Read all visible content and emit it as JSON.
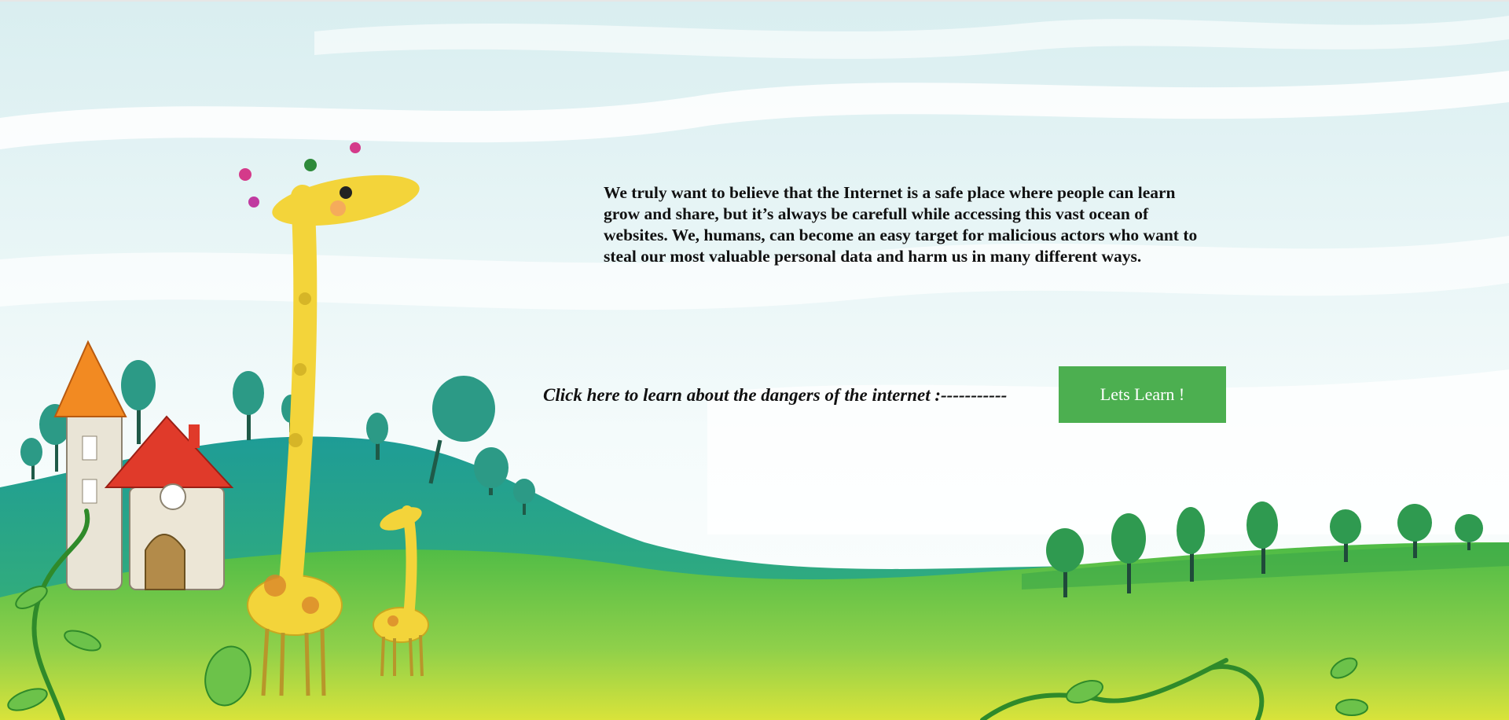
{
  "intro": {
    "text": "We truly want to believe that the Internet is a safe place where people can learn grow and share, but it’s always be carefull while accessing this vast ocean of websites. We, humans, can become an easy target for malicious actors who want to steal our most valuable personal data and harm us in many different ways."
  },
  "cta": {
    "text": "Click here to learn about the dangers of the internet :-----------",
    "button_label": "Lets Learn !",
    "button_color": "#4caf50"
  },
  "illustration": {
    "sky_color": "#dff1f2",
    "grass_color": "#5cc04a",
    "hill_color": "#29a59a",
    "giraffe_color": "#f3d43a"
  }
}
